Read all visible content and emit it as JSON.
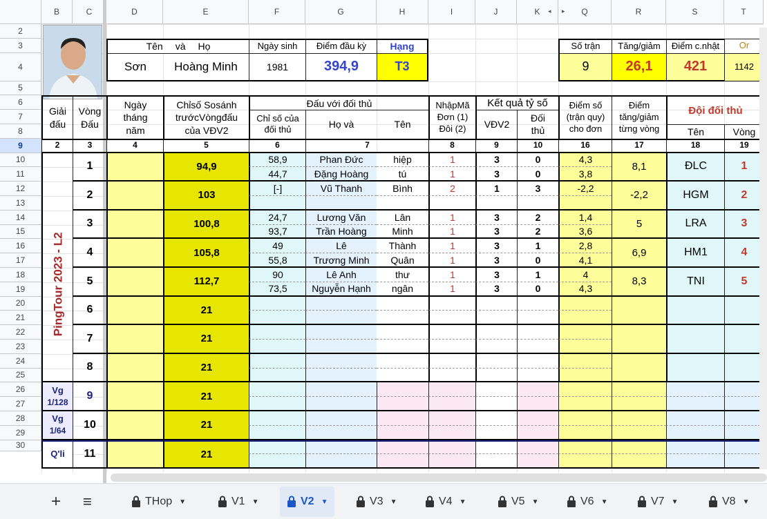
{
  "columns": [
    "B",
    "C",
    "D",
    "E",
    "F",
    "G",
    "H",
    "I",
    "J",
    "K",
    "Q",
    "R",
    "S",
    "T"
  ],
  "rows": [
    "2",
    "3",
    "4",
    "5",
    "6",
    "7",
    "8",
    "9",
    "10",
    "11",
    "12",
    "13",
    "14",
    "15",
    "16",
    "17",
    "18",
    "19",
    "20",
    "21",
    "22",
    "23",
    "24",
    "25",
    "26",
    "27",
    "28",
    "29",
    "30"
  ],
  "profile": {
    "name_header_1": "Tên",
    "name_header_2": "và",
    "name_header_3": "Họ",
    "birth_header": "Ngày sinh",
    "score_start_header": "Điểm đầu kỳ",
    "rank_header": "Hạng",
    "first_name": "Sơn",
    "last_name": "Hoàng Minh",
    "birth_year": "1981",
    "score_start": "394,9",
    "rank": "T3"
  },
  "summary": {
    "matches_header": "Số trận",
    "delta_header": "Tăng/giảm",
    "updated_header": "Điểm c.nhật",
    "or_header": "Or",
    "matches": "9",
    "delta": "26,1",
    "updated": "421",
    "or": "1142"
  },
  "headers": {
    "tournament": "Giải đấu",
    "round": "Vòng Đấu",
    "date": "Ngày tháng năm",
    "index_compare": "Chỉsố Sosánh trướcVòngđấu của VĐV2",
    "vs_opponent": "Đấu với đối thủ",
    "opp_index": "Chỉ số của đối thủ",
    "ho_va": "Họ    và",
    "ten": "Tên",
    "input_code": "NhậpMã Đơn (1) Đôi (2)",
    "result": "Kết quả tỷ số",
    "vdv2": "VĐV2",
    "opponent": "Đối thủ",
    "points": "Điểm số (trận quy) cho đơn",
    "points_change": "Điểm tăng/giảm từng vòng",
    "opp_team": "Đội đối thủ",
    "team_name": "Tên",
    "team_round": "Vòng"
  },
  "col_numbers": [
    "2",
    "3",
    "4",
    "5",
    "6",
    "7",
    "8",
    "9",
    "10",
    "16",
    "17",
    "18",
    "19"
  ],
  "tournament_name": "PingTour 2023 - L2",
  "rounds": [
    {
      "round": "1",
      "index": "94,9",
      "gain": "8,1",
      "team": "ĐLC",
      "team_round": "1",
      "matches": [
        {
          "opp_idx": "58,9",
          "ho": "Phan Đức",
          "ten": "hiệp",
          "code": "1",
          "vdv": "3",
          "opp": "0",
          "pts": "4,3"
        },
        {
          "opp_idx": "44,7",
          "ho": "Đặng Hoàng",
          "ten": "tú",
          "code": "1",
          "vdv": "3",
          "opp": "0",
          "pts": "3,8"
        }
      ]
    },
    {
      "round": "2",
      "index": "103",
      "gain": "-2,2",
      "team": "HGM",
      "team_round": "2",
      "matches": [
        {
          "opp_idx": "[-]",
          "ho": "Vũ Thanh",
          "ten": "Bình",
          "code": "2",
          "vdv": "1",
          "opp": "3",
          "pts": "-2,2"
        },
        {
          "opp_idx": "",
          "ho": "",
          "ten": "",
          "code": "",
          "vdv": "",
          "opp": "",
          "pts": ""
        }
      ]
    },
    {
      "round": "3",
      "index": "100,8",
      "gain": "5",
      "team": "LRA",
      "team_round": "3",
      "matches": [
        {
          "opp_idx": "24,7",
          "ho": "Lương Văn",
          "ten": "Lân",
          "code": "1",
          "vdv": "3",
          "opp": "2",
          "pts": "1,4"
        },
        {
          "opp_idx": "93,7",
          "ho": "Trần Hoàng",
          "ten": "Minh",
          "code": "1",
          "vdv": "3",
          "opp": "2",
          "pts": "3,6"
        }
      ]
    },
    {
      "round": "4",
      "index": "105,8",
      "gain": "6,9",
      "team": "HM1",
      "team_round": "4",
      "matches": [
        {
          "opp_idx": "49",
          "ho": "Lê",
          "ten": "Thành",
          "code": "1",
          "vdv": "3",
          "opp": "1",
          "pts": "2,8"
        },
        {
          "opp_idx": "55,8",
          "ho": "Trương Minh",
          "ten": "Quân",
          "code": "1",
          "vdv": "3",
          "opp": "0",
          "pts": "4,1"
        }
      ]
    },
    {
      "round": "5",
      "index": "112,7",
      "gain": "8,3",
      "team": "TNI",
      "team_round": "5",
      "matches": [
        {
          "opp_idx": "90",
          "ho": "Lê Anh",
          "ten": "thư",
          "code": "1",
          "vdv": "3",
          "opp": "1",
          "pts": "4"
        },
        {
          "opp_idx": "73,5",
          "ho": "Nguyễn Hạnh",
          "ten": "ngân",
          "code": "1",
          "vdv": "3",
          "opp": "0",
          "pts": "4,3"
        }
      ]
    },
    {
      "round": "6",
      "index": "21"
    },
    {
      "round": "7",
      "index": "21"
    },
    {
      "round": "8",
      "index": "21"
    }
  ],
  "later_rounds": [
    {
      "label_1": "Vg",
      "label_2": "1/128",
      "round": "9",
      "index": "21"
    },
    {
      "label_1": "Vg",
      "label_2": "1/64",
      "round": "10",
      "index": "21"
    },
    {
      "label_1": "Q'li",
      "label_2": "",
      "round": "11",
      "index": "21"
    }
  ],
  "tabs": [
    "THop",
    "V1",
    "V2",
    "V3",
    "V4",
    "V5",
    "V6",
    "V7",
    "V8"
  ],
  "active_tab": "V2",
  "colors": {
    "yellow": "#fdfd99",
    "olive": "#e6e600",
    "cyan": "#e0f7fa",
    "lightblue": "#e3f2fd",
    "pink": "#fce8f3",
    "lilac": "#ecebff"
  }
}
